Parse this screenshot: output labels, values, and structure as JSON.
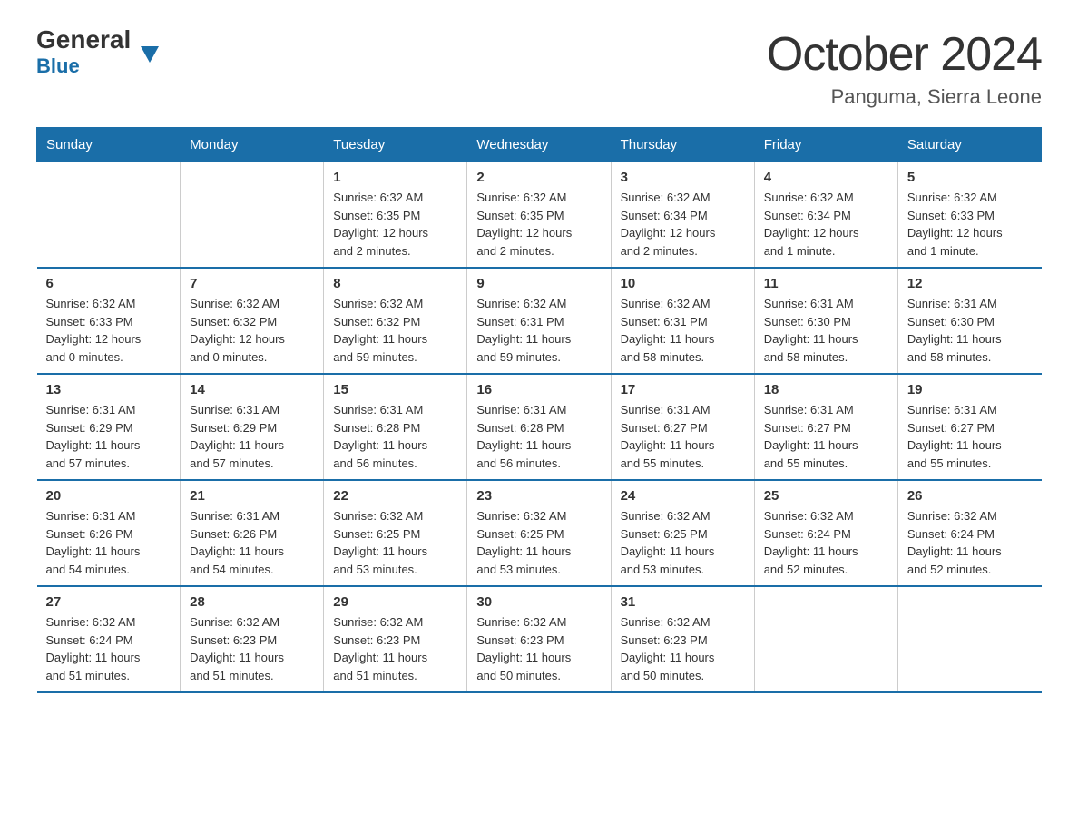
{
  "logo": {
    "part1": "General",
    "part2": "Blue"
  },
  "title": {
    "month": "October 2024",
    "location": "Panguma, Sierra Leone"
  },
  "weekdays": [
    "Sunday",
    "Monday",
    "Tuesday",
    "Wednesday",
    "Thursday",
    "Friday",
    "Saturday"
  ],
  "weeks": [
    [
      {
        "day": "",
        "info": ""
      },
      {
        "day": "",
        "info": ""
      },
      {
        "day": "1",
        "info": "Sunrise: 6:32 AM\nSunset: 6:35 PM\nDaylight: 12 hours\nand 2 minutes."
      },
      {
        "day": "2",
        "info": "Sunrise: 6:32 AM\nSunset: 6:35 PM\nDaylight: 12 hours\nand 2 minutes."
      },
      {
        "day": "3",
        "info": "Sunrise: 6:32 AM\nSunset: 6:34 PM\nDaylight: 12 hours\nand 2 minutes."
      },
      {
        "day": "4",
        "info": "Sunrise: 6:32 AM\nSunset: 6:34 PM\nDaylight: 12 hours\nand 1 minute."
      },
      {
        "day": "5",
        "info": "Sunrise: 6:32 AM\nSunset: 6:33 PM\nDaylight: 12 hours\nand 1 minute."
      }
    ],
    [
      {
        "day": "6",
        "info": "Sunrise: 6:32 AM\nSunset: 6:33 PM\nDaylight: 12 hours\nand 0 minutes."
      },
      {
        "day": "7",
        "info": "Sunrise: 6:32 AM\nSunset: 6:32 PM\nDaylight: 12 hours\nand 0 minutes."
      },
      {
        "day": "8",
        "info": "Sunrise: 6:32 AM\nSunset: 6:32 PM\nDaylight: 11 hours\nand 59 minutes."
      },
      {
        "day": "9",
        "info": "Sunrise: 6:32 AM\nSunset: 6:31 PM\nDaylight: 11 hours\nand 59 minutes."
      },
      {
        "day": "10",
        "info": "Sunrise: 6:32 AM\nSunset: 6:31 PM\nDaylight: 11 hours\nand 58 minutes."
      },
      {
        "day": "11",
        "info": "Sunrise: 6:31 AM\nSunset: 6:30 PM\nDaylight: 11 hours\nand 58 minutes."
      },
      {
        "day": "12",
        "info": "Sunrise: 6:31 AM\nSunset: 6:30 PM\nDaylight: 11 hours\nand 58 minutes."
      }
    ],
    [
      {
        "day": "13",
        "info": "Sunrise: 6:31 AM\nSunset: 6:29 PM\nDaylight: 11 hours\nand 57 minutes."
      },
      {
        "day": "14",
        "info": "Sunrise: 6:31 AM\nSunset: 6:29 PM\nDaylight: 11 hours\nand 57 minutes."
      },
      {
        "day": "15",
        "info": "Sunrise: 6:31 AM\nSunset: 6:28 PM\nDaylight: 11 hours\nand 56 minutes."
      },
      {
        "day": "16",
        "info": "Sunrise: 6:31 AM\nSunset: 6:28 PM\nDaylight: 11 hours\nand 56 minutes."
      },
      {
        "day": "17",
        "info": "Sunrise: 6:31 AM\nSunset: 6:27 PM\nDaylight: 11 hours\nand 55 minutes."
      },
      {
        "day": "18",
        "info": "Sunrise: 6:31 AM\nSunset: 6:27 PM\nDaylight: 11 hours\nand 55 minutes."
      },
      {
        "day": "19",
        "info": "Sunrise: 6:31 AM\nSunset: 6:27 PM\nDaylight: 11 hours\nand 55 minutes."
      }
    ],
    [
      {
        "day": "20",
        "info": "Sunrise: 6:31 AM\nSunset: 6:26 PM\nDaylight: 11 hours\nand 54 minutes."
      },
      {
        "day": "21",
        "info": "Sunrise: 6:31 AM\nSunset: 6:26 PM\nDaylight: 11 hours\nand 54 minutes."
      },
      {
        "day": "22",
        "info": "Sunrise: 6:32 AM\nSunset: 6:25 PM\nDaylight: 11 hours\nand 53 minutes."
      },
      {
        "day": "23",
        "info": "Sunrise: 6:32 AM\nSunset: 6:25 PM\nDaylight: 11 hours\nand 53 minutes."
      },
      {
        "day": "24",
        "info": "Sunrise: 6:32 AM\nSunset: 6:25 PM\nDaylight: 11 hours\nand 53 minutes."
      },
      {
        "day": "25",
        "info": "Sunrise: 6:32 AM\nSunset: 6:24 PM\nDaylight: 11 hours\nand 52 minutes."
      },
      {
        "day": "26",
        "info": "Sunrise: 6:32 AM\nSunset: 6:24 PM\nDaylight: 11 hours\nand 52 minutes."
      }
    ],
    [
      {
        "day": "27",
        "info": "Sunrise: 6:32 AM\nSunset: 6:24 PM\nDaylight: 11 hours\nand 51 minutes."
      },
      {
        "day": "28",
        "info": "Sunrise: 6:32 AM\nSunset: 6:23 PM\nDaylight: 11 hours\nand 51 minutes."
      },
      {
        "day": "29",
        "info": "Sunrise: 6:32 AM\nSunset: 6:23 PM\nDaylight: 11 hours\nand 51 minutes."
      },
      {
        "day": "30",
        "info": "Sunrise: 6:32 AM\nSunset: 6:23 PM\nDaylight: 11 hours\nand 50 minutes."
      },
      {
        "day": "31",
        "info": "Sunrise: 6:32 AM\nSunset: 6:23 PM\nDaylight: 11 hours\nand 50 minutes."
      },
      {
        "day": "",
        "info": ""
      },
      {
        "day": "",
        "info": ""
      }
    ]
  ]
}
